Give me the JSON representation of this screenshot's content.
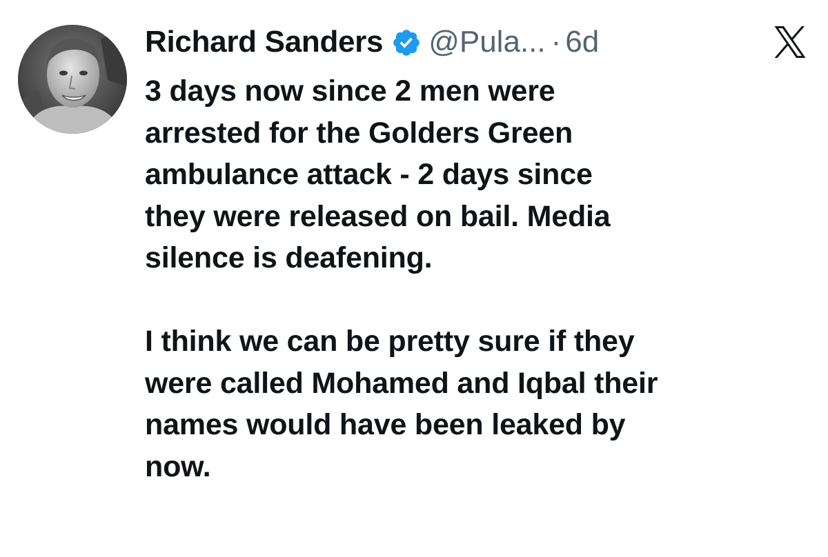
{
  "author": {
    "display_name": "Richard Sanders",
    "handle": "@Pula...",
    "separator": "·",
    "time": "6d",
    "verified": true
  },
  "icons": {
    "verified": "verified-badge-icon",
    "platform": "x-logo-icon",
    "verified_color": "#1d9bf0"
  },
  "tweet": {
    "paragraphs": [
      [
        "3 days now since 2 men were",
        "arrested for the Golders Green",
        "ambulance attack - 2 days since",
        "they were released on bail. Media",
        "silence is deafening."
      ],
      [
        "I think we can be pretty sure if they",
        "were called Mohamed and Iqbal their",
        "names would have been leaked by",
        "now."
      ]
    ]
  }
}
